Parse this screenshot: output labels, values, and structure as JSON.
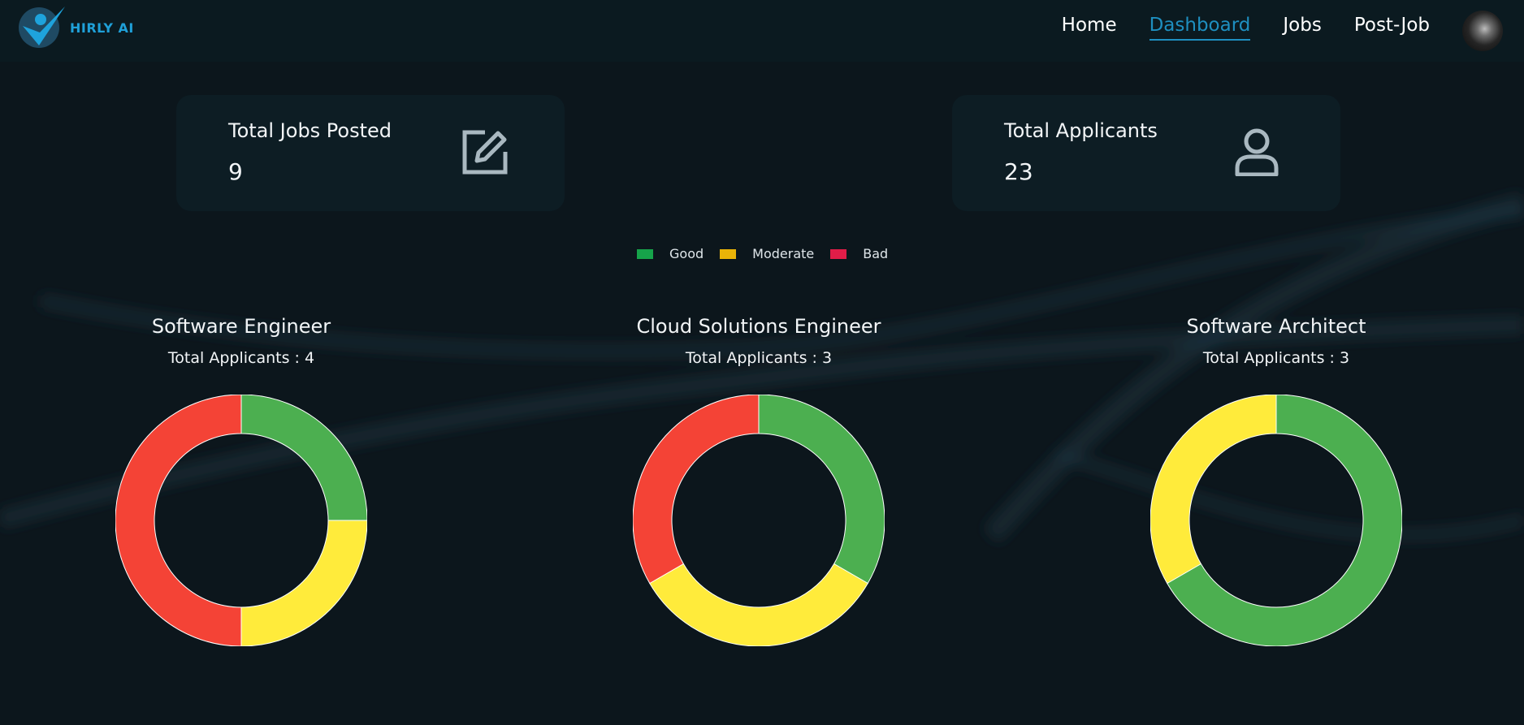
{
  "navbar": {
    "logo_text": "HIRLY AI",
    "links": [
      {
        "label": "Home",
        "active": false
      },
      {
        "label": "Dashboard",
        "active": true
      },
      {
        "label": "Jobs",
        "active": false
      },
      {
        "label": "Post-Job",
        "active": false
      }
    ],
    "accent": "#1e8fc0"
  },
  "stats": {
    "jobs": {
      "label": "Total Jobs Posted",
      "value": "9",
      "icon": "edit-icon"
    },
    "applicants": {
      "label": "Total Applicants",
      "value": "23",
      "icon": "user-icon"
    }
  },
  "legend": [
    {
      "label": "Good",
      "color": "#16a34a"
    },
    {
      "label": "Moderate",
      "color": "#eab308"
    },
    {
      "label": "Bad",
      "color": "#e11d48"
    }
  ],
  "chart_data": [
    {
      "type": "pie",
      "title": "Software Engineer",
      "subtitle": "Total Applicants : 4",
      "categories": [
        "Good",
        "Moderate",
        "Bad"
      ],
      "values": [
        1,
        1,
        2
      ],
      "colors": [
        "#4caf50",
        "#ffeb3b",
        "#f44336"
      ]
    },
    {
      "type": "pie",
      "title": "Cloud Solutions Engineer",
      "subtitle": "Total Applicants : 3",
      "categories": [
        "Good",
        "Moderate",
        "Bad"
      ],
      "values": [
        1,
        1,
        1
      ],
      "colors": [
        "#4caf50",
        "#ffeb3b",
        "#f44336"
      ]
    },
    {
      "type": "pie",
      "title": "Software Architect",
      "subtitle": "Total Applicants : 3",
      "categories": [
        "Good",
        "Moderate",
        "Bad"
      ],
      "values": [
        2,
        1,
        0
      ],
      "colors": [
        "#4caf50",
        "#ffeb3b",
        "#f44336"
      ]
    }
  ]
}
